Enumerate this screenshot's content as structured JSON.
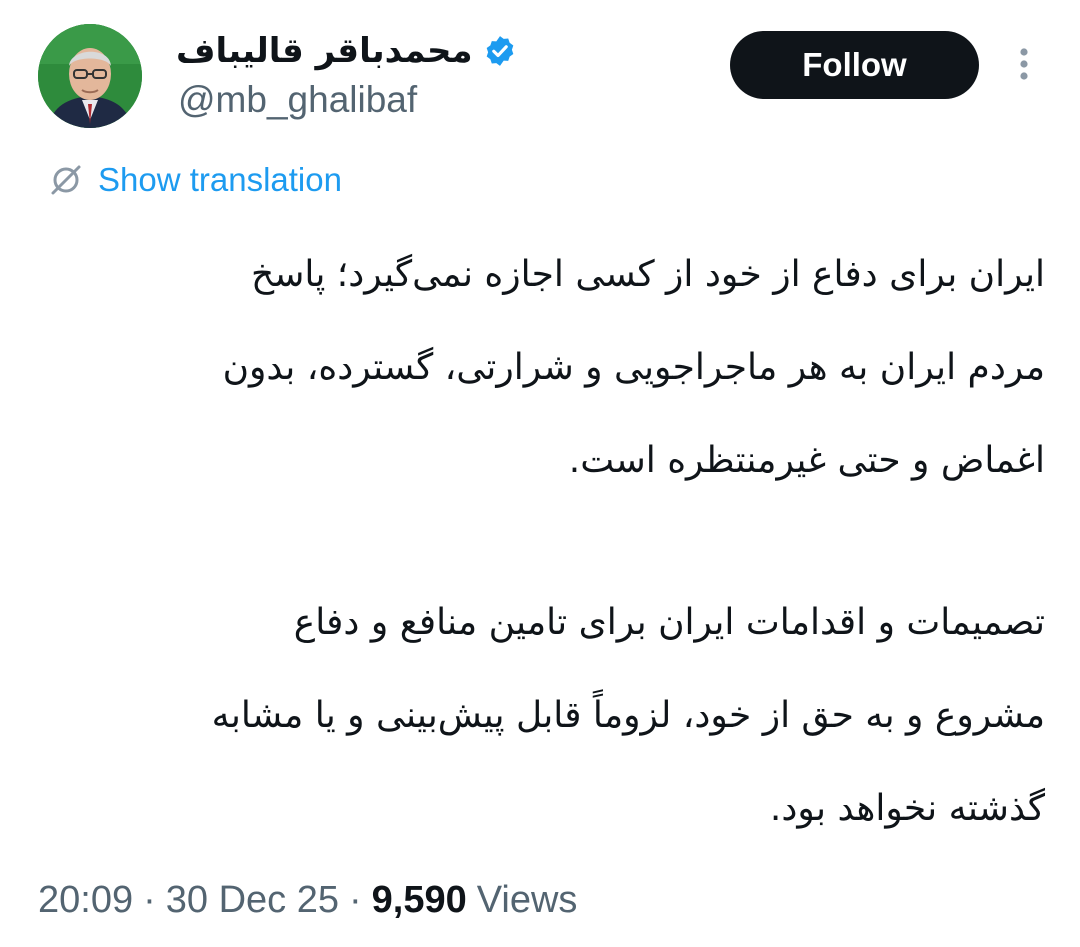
{
  "author": {
    "display_name": "محمدباقر قالیباف",
    "handle": "@mb_ghalibaf",
    "verified_icon": "verified-badge-icon",
    "avatar_icon": "avatar"
  },
  "header": {
    "follow_label": "Follow",
    "more_icon": "more-vertical-icon"
  },
  "translation": {
    "label": "Show translation",
    "icon": "translate-icon"
  },
  "tweet": {
    "paragraphs": [
      {
        "lines": [
          "ایران برای دفاع از خود از کسی اجازه نمی‌گیرد؛ پاسخ",
          "مردم ایران به هر ماجراجویی و شرارتی، گسترده، بدون",
          "اغماض و حتی غیرمنتظره است."
        ]
      },
      {
        "lines": [
          "تصمیمات و اقدامات ایران برای تامین منافع و دفاع",
          "مشروع و به حق از خود، لزوماً قابل پیش‌بینی و یا مشابه",
          "گذشته نخواهد بود."
        ]
      }
    ]
  },
  "meta": {
    "time": "20:09",
    "separator": "·",
    "date": "30 Dec 25",
    "views_count": "9,590",
    "views_label": "Views"
  },
  "colors": {
    "text": "#0f1419",
    "secondary": "#536471",
    "accent": "#1d9bf0",
    "follow_bg": "#0f1419"
  }
}
